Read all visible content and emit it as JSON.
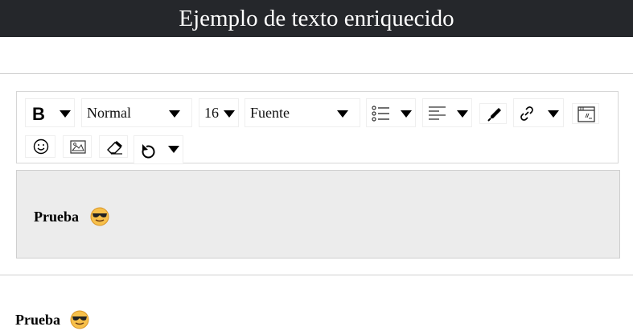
{
  "header": {
    "title": "Ejemplo de texto enriquecido"
  },
  "toolbar": {
    "bold_label": "B",
    "block_type": "Normal",
    "font_size": "16",
    "font_family": "Fuente"
  },
  "editor": {
    "text": "Prueba",
    "emoji": "sunglasses-emoji"
  },
  "preview": {
    "text": "Prueba",
    "emoji": "sunglasses-emoji"
  }
}
